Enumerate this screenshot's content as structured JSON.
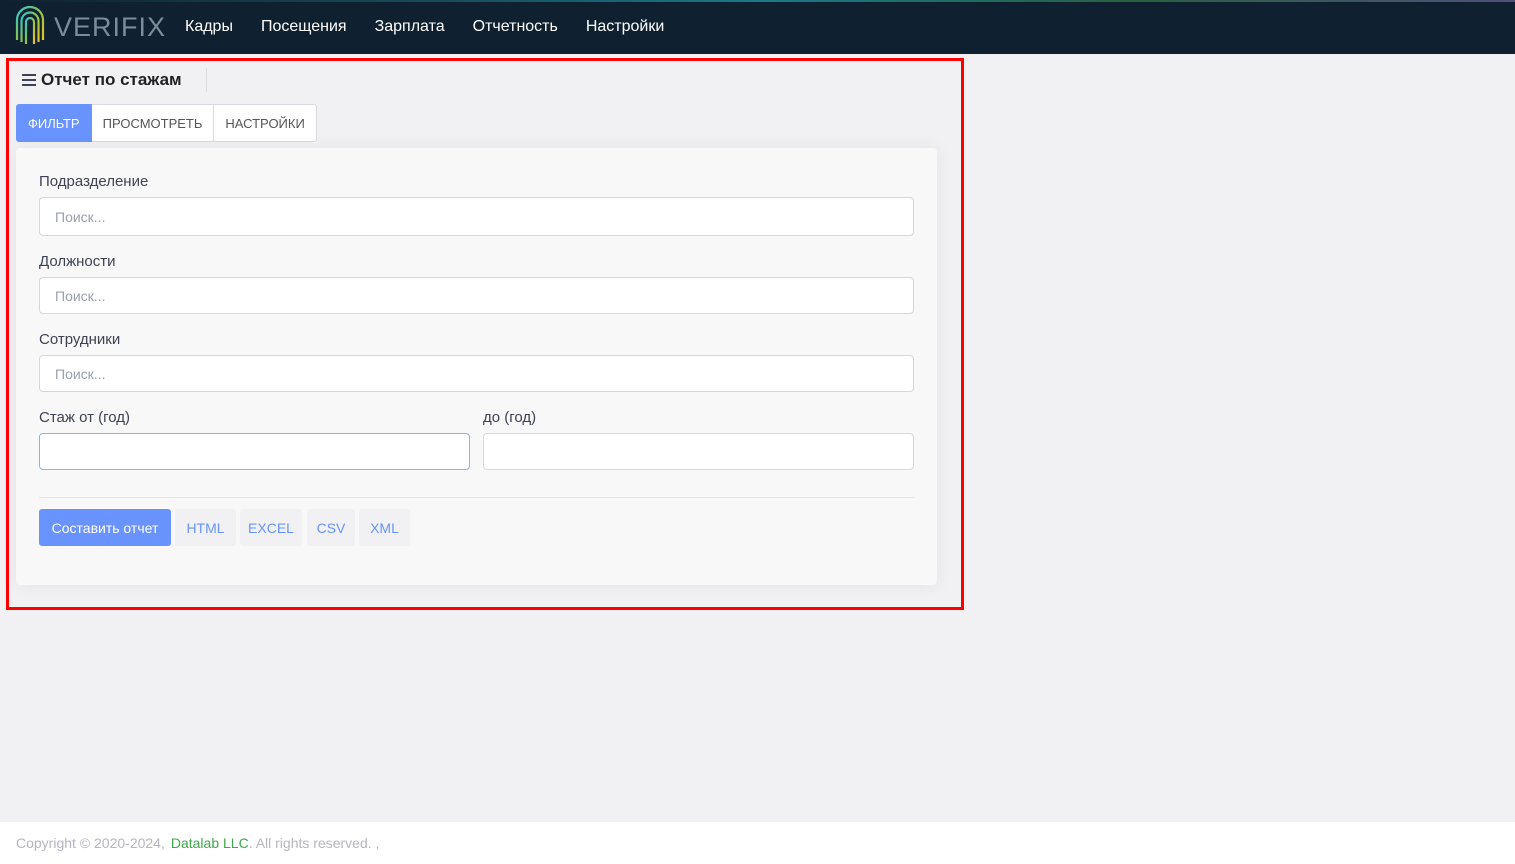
{
  "app": {
    "logo_text": "VERIFIX"
  },
  "nav": {
    "items": [
      "Кадры",
      "Посещения",
      "Зарплата",
      "Отчетность",
      "Настройки"
    ]
  },
  "page": {
    "title": "Отчет по стажам"
  },
  "tabs": [
    {
      "label": "ФИЛЬТР",
      "active": true
    },
    {
      "label": "ПРОСМОТРЕТЬ",
      "active": false
    },
    {
      "label": "НАСТРОЙКИ",
      "active": false
    }
  ],
  "form": {
    "division": {
      "label": "Подразделение",
      "placeholder": "Поиск...",
      "value": ""
    },
    "positions": {
      "label": "Должности",
      "placeholder": "Поиск...",
      "value": ""
    },
    "employees": {
      "label": "Сотрудники",
      "placeholder": "Поиск...",
      "value": ""
    },
    "tenure_from": {
      "label": "Стаж от (год)",
      "value": ""
    },
    "tenure_to": {
      "label": "до (год)",
      "value": ""
    }
  },
  "actions": {
    "build_report": "Составить отчет",
    "html": "HTML",
    "excel": "EXCEL",
    "csv": "CSV",
    "xml": "XML"
  },
  "footer": {
    "copyright": "Copyright © 2020-2024,",
    "company": "Datalab LLC",
    "rights": ". All rights reserved. ,"
  },
  "colors": {
    "navbar": "#0f2130",
    "primary": "#6993ff",
    "highlight": "#ff0000",
    "footer_link": "#3fa84a"
  }
}
